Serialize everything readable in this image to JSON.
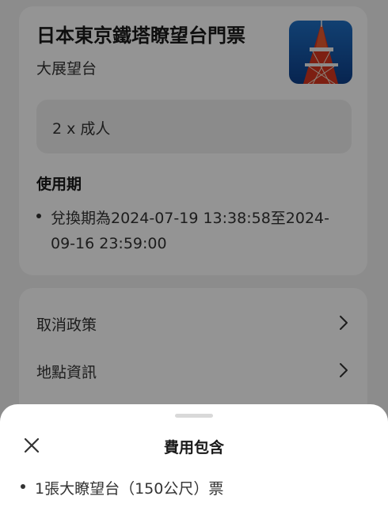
{
  "ticket": {
    "title": "日本東京鐵塔瞭望台門票",
    "subtitle": "大展望台",
    "thumbnail": "tokyo-tower-photo",
    "quantity": "2 x 成人",
    "period_label": "使用期",
    "period_text": "兌換期為2024-07-19 13:38:58至2024-09-16 23:59:00"
  },
  "links": [
    {
      "label": "取消政策",
      "icon": "chevron-right-icon"
    },
    {
      "label": "地點資訊",
      "icon": "chevron-right-icon"
    }
  ],
  "sheet": {
    "title": "費用包含",
    "close_icon": "close-icon",
    "items": [
      "1張大瞭望台（150公尺）票"
    ]
  },
  "colors": {
    "overlay": "#6b6b6b",
    "sheet_background": "#ffffff",
    "card_background": "#ffffff"
  }
}
